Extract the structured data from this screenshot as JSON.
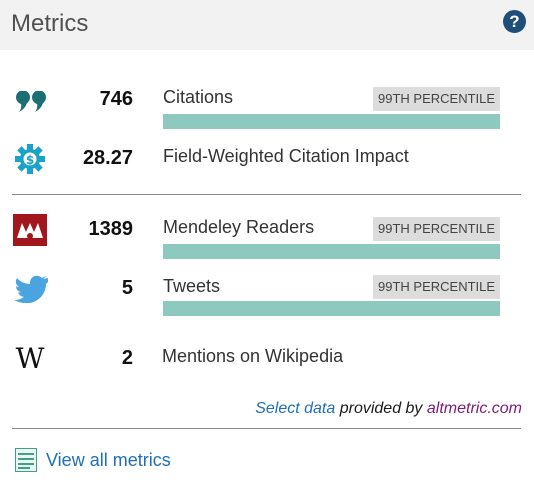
{
  "header": {
    "title": "Metrics",
    "help": "?"
  },
  "metrics": [
    {
      "value": "746",
      "label": "Citations",
      "percentile": "99TH PERCENTILE",
      "bar": 1.0
    },
    {
      "value": "28.27",
      "label": "Field-Weighted Citation Impact"
    },
    {
      "value": "1389",
      "label": "Mendeley Readers",
      "percentile": "99TH PERCENTILE",
      "bar": 1.0
    },
    {
      "value": "5",
      "label": "Tweets",
      "percentile": "99TH PERCENTILE",
      "bar": 1.0
    },
    {
      "value": "2",
      "label": "Mentions on Wikipedia"
    }
  ],
  "provided_by": {
    "link1": "Select data",
    "middle": " provided by ",
    "link2": "altmetric.com"
  },
  "footer": {
    "view_all": "View all metrics"
  },
  "icons": {
    "citations": "quote-icon",
    "fwci": "gear-dollar-icon",
    "mendeley": "mendeley-icon",
    "tweets": "twitter-bird-icon",
    "wikipedia": "wikipedia-icon",
    "view_all": "document-list-icon"
  }
}
